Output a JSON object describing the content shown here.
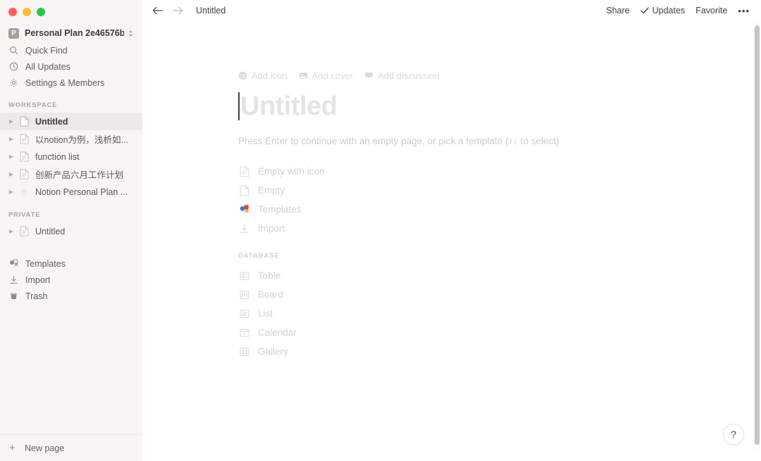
{
  "window": {
    "traffic_lights": [
      {
        "name": "close",
        "color": "#ff5f57"
      },
      {
        "name": "minimize",
        "color": "#febc2e"
      },
      {
        "name": "zoom",
        "color": "#28c840"
      }
    ]
  },
  "sidebar": {
    "workspace_switcher": {
      "avatar_letter": "P",
      "name": "Personal Plan 2e46576b"
    },
    "top_nav": [
      {
        "icon": "search-icon",
        "label": "Quick Find"
      },
      {
        "icon": "clock-icon",
        "label": "All Updates"
      },
      {
        "icon": "gear-icon",
        "label": "Settings & Members"
      }
    ],
    "workspace_section": {
      "heading": "WORKSPACE",
      "pages": [
        {
          "label": "Untitled",
          "icon": "page-icon",
          "selected": true
        },
        {
          "label": "以notion为例，浅析如...",
          "icon": "page-lines-icon",
          "selected": false
        },
        {
          "label": "function list",
          "icon": "page-lines-icon",
          "selected": false
        },
        {
          "label": "创新产品六月工作计划",
          "icon": "page-lines-icon",
          "selected": false
        },
        {
          "label": "Notion Personal Plan ...",
          "icon": "emoji-icon",
          "selected": false
        }
      ]
    },
    "private_section": {
      "heading": "PRIVATE",
      "pages": [
        {
          "label": "Untitled",
          "icon": "page-lines-icon",
          "selected": false
        }
      ]
    },
    "bottom_nav": [
      {
        "icon": "templates-icon",
        "label": "Templates"
      },
      {
        "icon": "import-icon",
        "label": "Import"
      },
      {
        "icon": "trash-icon",
        "label": "Trash"
      }
    ],
    "new_page": {
      "icon": "plus-icon",
      "label": "New page"
    }
  },
  "topbar": {
    "back_icon": "arrow-left-icon",
    "forward_icon": "arrow-right-icon",
    "breadcrumb": "Untitled",
    "share_label": "Share",
    "updates_label": "Updates",
    "updates_icon": "check-icon",
    "favorite_label": "Favorite",
    "more_label": "•••"
  },
  "page": {
    "meta_actions": [
      {
        "icon": "smiley-icon",
        "label": "Add icon"
      },
      {
        "icon": "image-icon",
        "label": "Add cover"
      },
      {
        "icon": "comment-icon",
        "label": "Add discussion"
      }
    ],
    "title_placeholder": "Untitled",
    "hint": "Press Enter to continue with an empty page, or pick a template (↑↓ to select)",
    "template_options": [
      {
        "icon": "page-lines-icon",
        "label": "Empty with icon"
      },
      {
        "icon": "page-blank-icon",
        "label": "Empty"
      },
      {
        "icon": "templates-color-icon",
        "label": "Templates"
      },
      {
        "icon": "import-icon",
        "label": "Import"
      }
    ],
    "database_heading": "DATABASE",
    "database_options": [
      {
        "icon": "table-icon",
        "label": "Table"
      },
      {
        "icon": "board-icon",
        "label": "Board"
      },
      {
        "icon": "list-icon",
        "label": "List"
      },
      {
        "icon": "calendar-icon",
        "label": "Calendar"
      },
      {
        "icon": "gallery-icon",
        "label": "Gallery"
      }
    ]
  },
  "help": {
    "label": "?"
  },
  "colors": {
    "sidebar_bg": "#f7f6f3",
    "selected_row": "#ebeae8",
    "main_bg": "#ffffff",
    "placeholder_gray": "#e6e4e1"
  }
}
